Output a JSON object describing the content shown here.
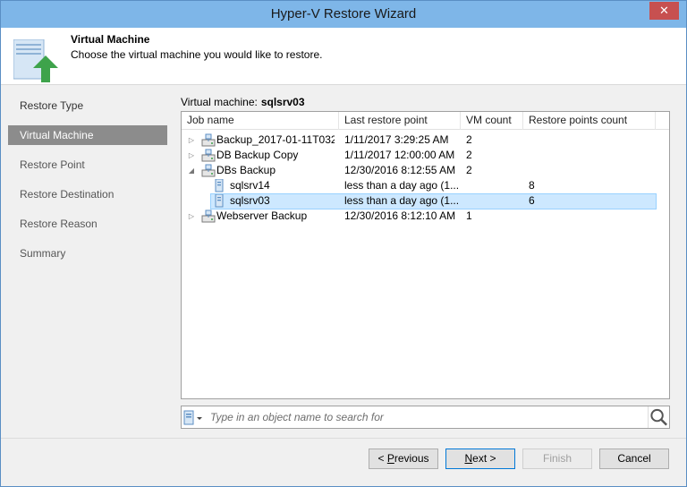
{
  "window": {
    "title": "Hyper-V Restore Wizard",
    "close_glyph": "✕"
  },
  "header": {
    "title": "Virtual Machine",
    "description": "Choose the virtual machine you would like to restore."
  },
  "sidebar": {
    "items": [
      {
        "label": "Restore Type"
      },
      {
        "label": "Virtual Machine"
      },
      {
        "label": "Restore Point"
      },
      {
        "label": "Restore Destination"
      },
      {
        "label": "Restore Reason"
      },
      {
        "label": "Summary"
      }
    ],
    "active_index": 1
  },
  "main": {
    "vm_label": "Virtual machine:",
    "vm_value": "sqlsrv03",
    "columns": [
      "Job name",
      "Last restore point",
      "VM count",
      "Restore points count"
    ],
    "rows": [
      {
        "name": "Backup_2017-01-11T032...",
        "last": "1/11/2017 3:29:25 AM",
        "vm_count": "2",
        "rp_count": "",
        "level": 0,
        "expanded": false,
        "type": "job"
      },
      {
        "name": "DB Backup Copy",
        "last": "1/11/2017 12:00:00 AM",
        "vm_count": "2",
        "rp_count": "",
        "level": 0,
        "expanded": false,
        "type": "job"
      },
      {
        "name": "DBs Backup",
        "last": "12/30/2016 8:12:55 AM",
        "vm_count": "2",
        "rp_count": "",
        "level": 0,
        "expanded": true,
        "type": "job"
      },
      {
        "name": "sqlsrv14",
        "last": "less than a day ago (1...",
        "vm_count": "",
        "rp_count": "8",
        "level": 1,
        "type": "vm"
      },
      {
        "name": "sqlsrv03",
        "last": "less than a day ago (1...",
        "vm_count": "",
        "rp_count": "6",
        "level": 1,
        "type": "vm",
        "selected": true
      },
      {
        "name": "Webserver Backup",
        "last": "12/30/2016 8:12:10 AM",
        "vm_count": "1",
        "rp_count": "",
        "level": 0,
        "expanded": false,
        "type": "job"
      }
    ],
    "search": {
      "placeholder": "Type in an object name to search for",
      "value": ""
    }
  },
  "footer": {
    "previous_label": "< Previous",
    "next_label": "Next >",
    "finish_label": "Finish",
    "cancel_label": "Cancel"
  },
  "colors": {
    "titlebar": "#7eb6e8",
    "selection": "#cde8ff",
    "active_nav": "#8c8c8c",
    "close": "#c75050"
  }
}
